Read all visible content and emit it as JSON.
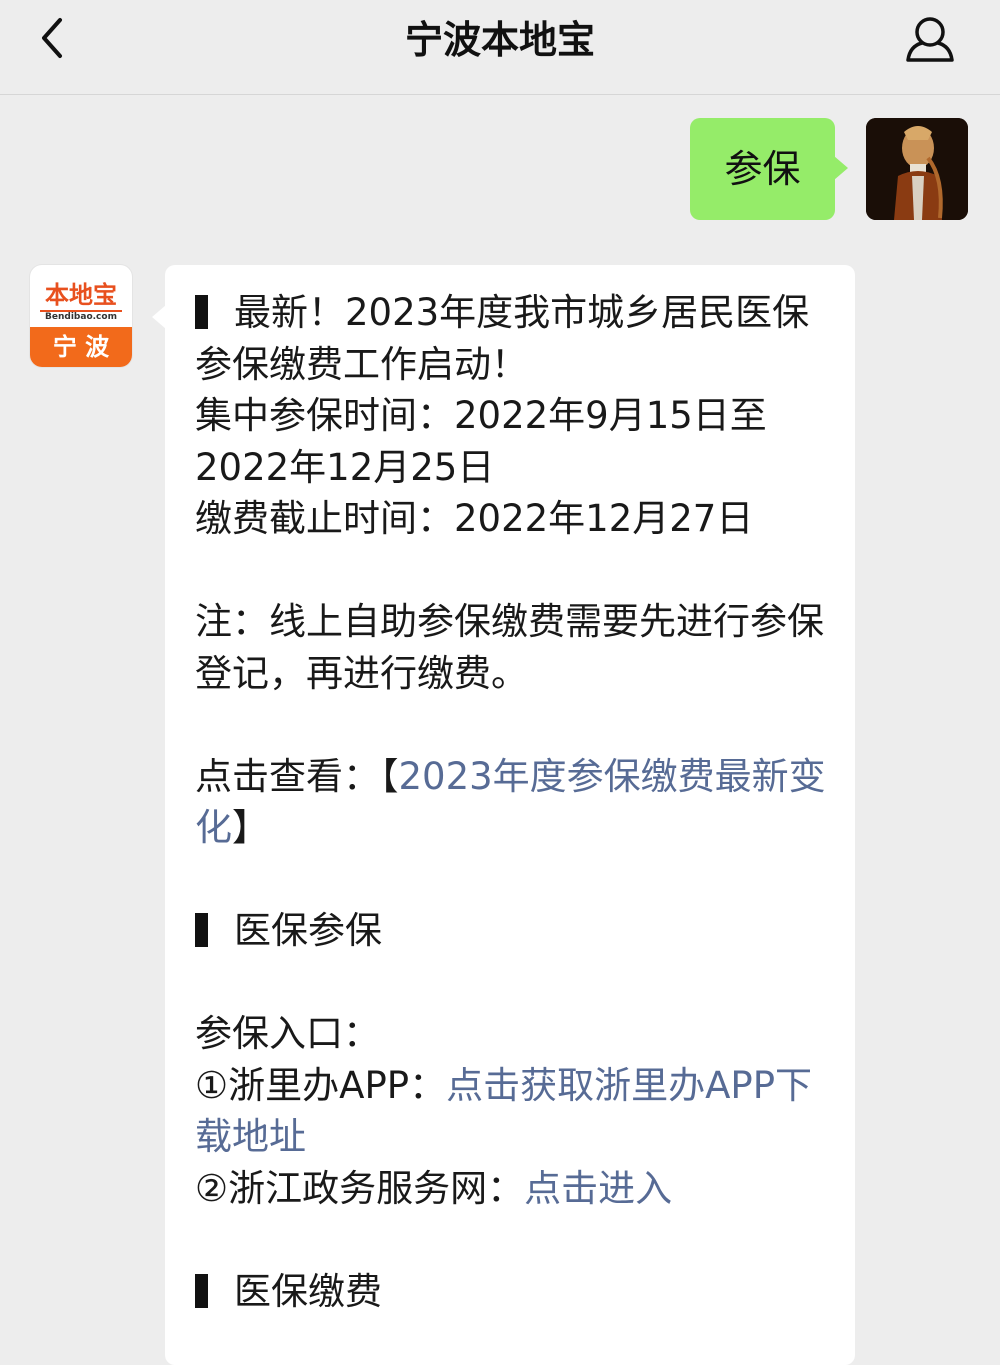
{
  "header": {
    "title": "宁波本地宝"
  },
  "user_message": {
    "text": "参保"
  },
  "bot": {
    "logo_top": "本地宝",
    "logo_domain": "Bendibao.com",
    "logo_city": "宁 波"
  },
  "message": {
    "headline": "最新！2023年度我市城乡居民医保参保缴费工作启动！",
    "period": "集中参保时间：2022年9月15日至2022年12月25日",
    "deadline": "缴费截止时间：2022年12月27日",
    "note": "注：线上自助参保缴费需要先进行参保登记，再进行缴费。",
    "click_prefix": "点击查看：",
    "bracket_open": "【",
    "click_link": "2023年度参保缴费最新变化",
    "bracket_close": "】",
    "section1_title": "医保参保",
    "entry_label": "参保入口：",
    "entry1_prefix": "①浙里办APP：",
    "entry1_link": "点击获取浙里办APP下载地址",
    "entry2_prefix": "②浙江政务服务网：",
    "entry2_link": "点击进入",
    "section2_title": "医保缴费"
  },
  "colors": {
    "background": "#ededed",
    "user_bubble": "#95ec69",
    "link": "#576b95",
    "logo_orange": "#f26a1b"
  }
}
